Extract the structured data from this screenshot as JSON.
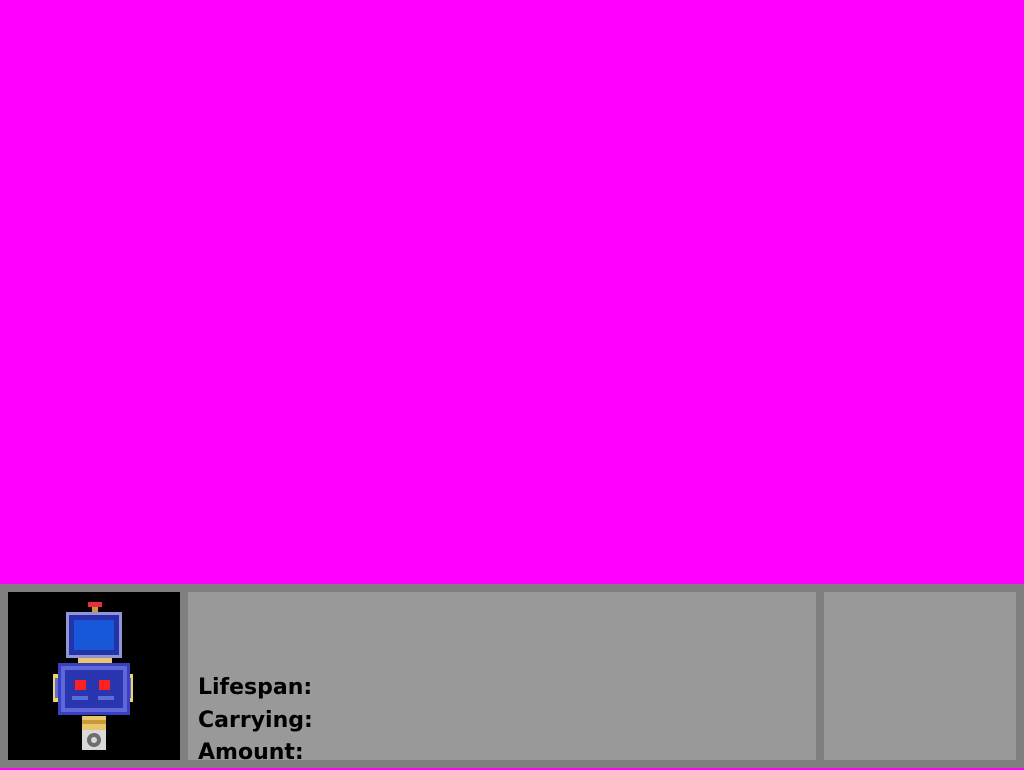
{
  "colors": {
    "viewport_background": "#ff00ff",
    "hud_frame": "#7f7f7f",
    "panel": "#999999",
    "portrait_background": "#000000"
  },
  "portrait": {
    "icon": "robot-icon"
  },
  "stats": {
    "lifespan_label": "Lifespan:",
    "lifespan_value": "",
    "carrying_label": "Carrying:",
    "carrying_value": "",
    "amount_label": "Amount:",
    "amount_value": ""
  }
}
